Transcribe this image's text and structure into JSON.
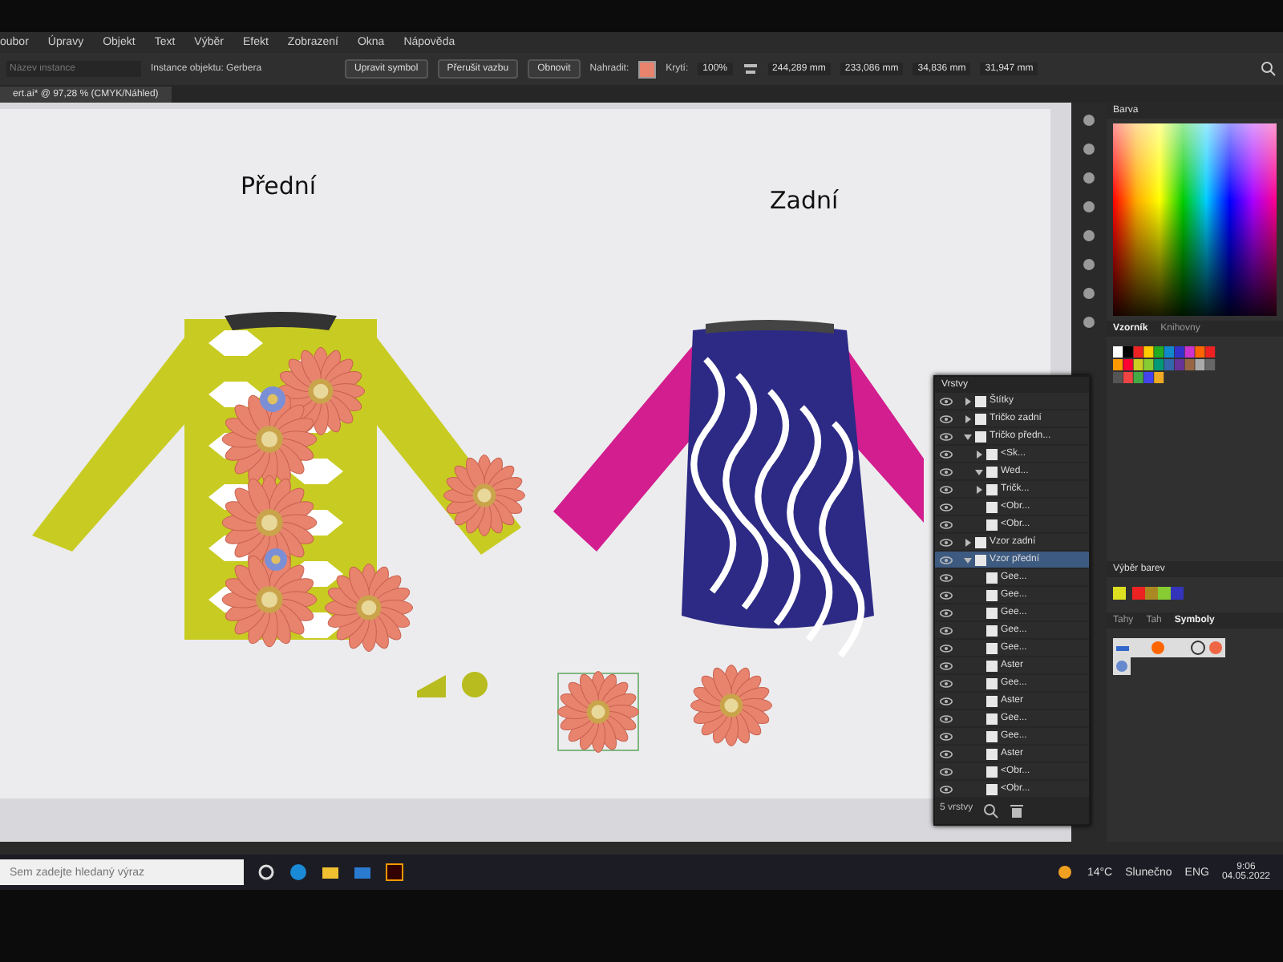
{
  "menu": [
    "oubor",
    "Úpravy",
    "Objekt",
    "Text",
    "Výběr",
    "Efekt",
    "Zobrazení",
    "Okna",
    "Nápověda"
  ],
  "control_bar": {
    "instance_placeholder": "Název instance",
    "instance_label": "Instance objektu: Gerbera",
    "buttons": [
      "Upravit symbol",
      "Přerušit vazbu",
      "Obnovit"
    ],
    "replace_label": "Nahradit:",
    "opacity_label": "Krytí:",
    "opacity_value": "100%",
    "transform_fields": [
      "244,289 mm",
      "233,086 mm",
      "34,836 mm",
      "31,947 mm"
    ]
  },
  "document_tab": {
    "title": "ert.ai* @ 97,28 % (CMYK/Náhled)"
  },
  "artboard": {
    "labels": [
      "Přední",
      "Zadní"
    ]
  },
  "layers_panel": {
    "title": "Vrstvy",
    "footer": "5 vrstvy",
    "items": [
      {
        "name": "Štítky",
        "expanded": false,
        "selected": false
      },
      {
        "name": "Tričko zadní",
        "expanded": false,
        "selected": false
      },
      {
        "name": "Tričko předn...",
        "expanded": true,
        "selected": false,
        "children": [
          {
            "name": "<Sk...",
            "expanded": false,
            "selected": false
          },
          {
            "name": "Wed...",
            "expanded": true,
            "selected": false
          },
          {
            "name": "Tričk...",
            "expanded": false,
            "selected": false
          },
          {
            "name": "<Obr...",
            "selected": false
          },
          {
            "name": "<Obr...",
            "selected": false
          }
        ]
      },
      {
        "name": "Vzor zadní",
        "expanded": false,
        "selected": false
      },
      {
        "name": "Vzor přední",
        "expanded": true,
        "selected": true,
        "children": [
          {
            "name": "Gee...",
            "selected": false
          },
          {
            "name": "Gee...",
            "selected": false
          },
          {
            "name": "Gee...",
            "selected": false
          },
          {
            "name": "Gee...",
            "selected": false
          },
          {
            "name": "Gee...",
            "selected": false
          },
          {
            "name": "Aster",
            "selected": false
          },
          {
            "name": "Gee...",
            "selected": false
          },
          {
            "name": "Aster",
            "selected": false
          },
          {
            "name": "Gee...",
            "selected": false
          },
          {
            "name": "Gee...",
            "selected": false
          },
          {
            "name": "Aster",
            "selected": false
          },
          {
            "name": "<Obr...",
            "selected": false
          },
          {
            "name": "<Obr...",
            "selected": false
          }
        ]
      }
    ]
  },
  "color_panel": {
    "title": "Barva"
  },
  "swatches_panel": {
    "tabs": [
      {
        "label": "Vzorník",
        "selected": true
      },
      {
        "label": "Knihovny",
        "selected": false
      }
    ]
  },
  "color_guide_panel": {
    "title": "Výběr barev"
  },
  "symbols_panel": {
    "tabs": [
      {
        "label": "Tahy",
        "selected": false
      },
      {
        "label": "Tah",
        "selected": false
      },
      {
        "label": "Symboly",
        "selected": true
      }
    ]
  },
  "taskbar": {
    "search_placeholder": "Sem zadejte hledaný výraz",
    "weather": "14°C",
    "weather_text": "Slunečno",
    "language": "ENG",
    "time": "9:06",
    "date": "04.05.2022"
  }
}
